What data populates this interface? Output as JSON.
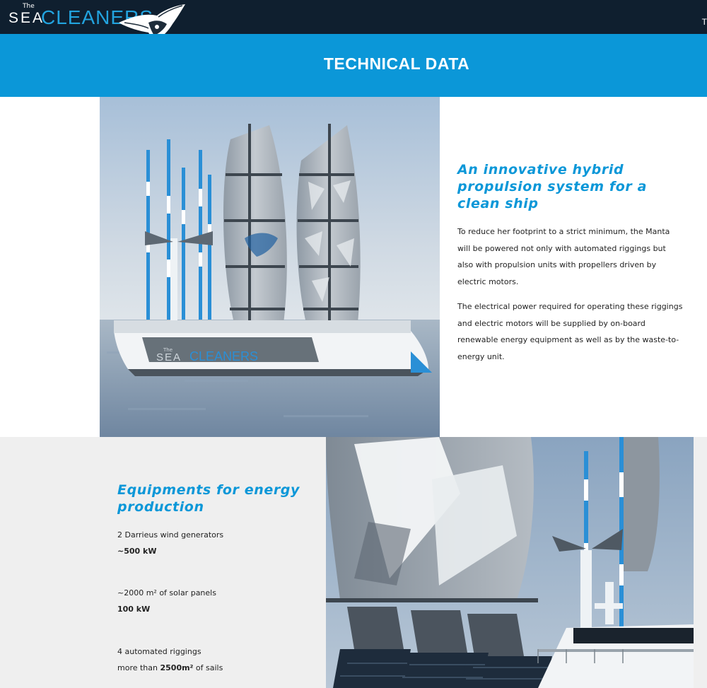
{
  "header": {
    "logo_the": "The",
    "logo_sea": "SEA",
    "logo_cleaners": "CLEANERS",
    "edge_text": "T"
  },
  "banner": {
    "title": "TECHNICAL DATA"
  },
  "section1": {
    "heading": "An innovative hybrid propulsion system for a clean ship",
    "paragraphs": [
      "To reduce her footprint to a strict minimum, the Manta will be powered not only with automated riggings but also with propulsion units with propellers driven by electric motors.",
      "The electrical power required for operating these riggings and electric motors will be supplied by on-board renewable energy equipment as well as by the waste-to-energy unit."
    ],
    "image_hull_text": {
      "the": "The",
      "sea": "SEA",
      "cleaners": "CLEANERS"
    }
  },
  "section2": {
    "heading": "Equipments for energy production",
    "specs": [
      {
        "label": "2 Darrieus wind generators",
        "value": "~500 kW"
      },
      {
        "label": "~2000 m² of solar panels",
        "value": "100 kW"
      },
      {
        "label_prefix": "4 automated riggings",
        "value_prefix": "more than ",
        "value_strong": "2500m²",
        "value_suffix": " of sails"
      }
    ]
  },
  "colors": {
    "topbar": "#0f1f2f",
    "banner": "#0b97d8",
    "accent": "#0b97d8",
    "section2_bg": "#efefef"
  },
  "icons": {
    "logo": "manta-ray-icon"
  }
}
